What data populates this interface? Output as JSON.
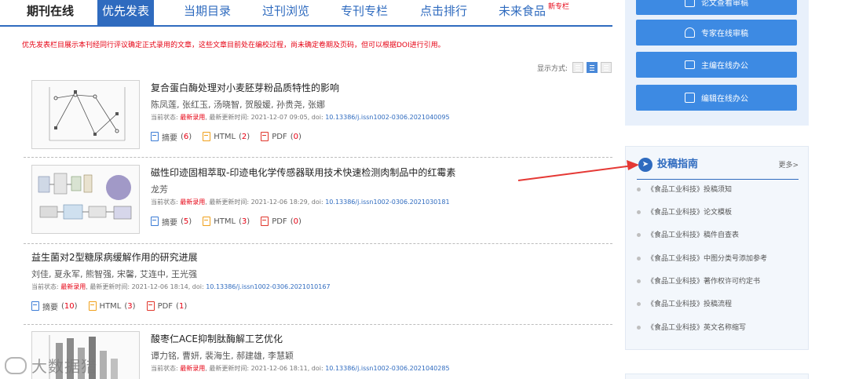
{
  "tabs": {
    "journal_online": "期刊在线",
    "priority": "优先发表",
    "current_toc": "当期目录",
    "past_browse": "过刊浏览",
    "special_column": "专刊专栏",
    "click_rank": "点击排行",
    "future_food": "未来食品",
    "new_badge": "新专栏"
  },
  "notice": "优先发表栏目展示本刊经同行评议确定正式录用的文章，这些文章目前处在编校过程，尚未确定卷期及页码，但可以根据DOI进行引用。",
  "display_mode": {
    "label": "显示方式:",
    "icons": [
      "grid-view-icon",
      "list-view-icon",
      "text-view-icon"
    ],
    "active_index": 1
  },
  "articles": [
    {
      "title": "复合蛋白酶处理对小麦胚芽粉品质特性的影响",
      "authors": "陈凤莲, 张红玉, 汤晓智, 贺殷媛, 孙贵尧, 张娜",
      "status_label": "当前状态:",
      "status": "最新录用",
      "updated_label": "最新更新时间:",
      "updated": "2021-12-07 09:05",
      "doi_label": "doi:",
      "doi": "10.13386/j.issn1002-0306.2021040095",
      "abstract_label": "摘要",
      "abstract_count": "6",
      "html_label": "HTML",
      "html_count": "2",
      "pdf_label": "PDF",
      "pdf_count": "0",
      "has_thumb": true
    },
    {
      "title": "磁性印迹固相萃取-印迹电化学传感器联用技术快速检测肉制品中的红霉素",
      "authors": "龙芳",
      "status_label": "当前状态:",
      "status": "最新录用",
      "updated_label": "最新更新时间:",
      "updated": "2021-12-06 18:29",
      "doi_label": "doi:",
      "doi": "10.13386/j.issn1002-0306.2021030181",
      "abstract_label": "摘要",
      "abstract_count": "5",
      "html_label": "HTML",
      "html_count": "3",
      "pdf_label": "PDF",
      "pdf_count": "0",
      "has_thumb": true
    },
    {
      "title": "益生菌对2型糖尿病缓解作用的研究进展",
      "authors": "刘佳, 夏永军, 熊智强, 宋馨, 艾连中, 王光强",
      "status_label": "当前状态:",
      "status": "最新录用",
      "updated_label": "最新更新时间:",
      "updated": "2021-12-06 18:14",
      "doi_label": "doi:",
      "doi": "10.13386/j.issn1002-0306.2021010167",
      "abstract_label": "摘要",
      "abstract_count": "10",
      "html_label": "HTML",
      "html_count": "3",
      "pdf_label": "PDF",
      "pdf_count": "1",
      "has_thumb": false
    },
    {
      "title": "酸枣仁ACE抑制肽酶解工艺优化",
      "authors": "谭力铭, 曹妍, 裴海生, 郝建雄, 李慧颖",
      "status_label": "当前状态:",
      "status": "最新录用",
      "updated_label": "最新更新时间:",
      "updated": "2021-12-06 18:11",
      "doi_label": "doi:",
      "doi": "10.13386/j.issn1002-0306.2021040285",
      "has_thumb": true
    }
  ],
  "sidebar": {
    "buttons": [
      {
        "label": "论文查看审稿",
        "icon": "document-icon"
      },
      {
        "label": "专家在线审稿",
        "icon": "user-icon"
      },
      {
        "label": "主编在线办公",
        "icon": "monitor-icon"
      },
      {
        "label": "编辑在线办公",
        "icon": "edit-icon"
      }
    ],
    "guide": {
      "title": "投稿指南",
      "more": "更多>",
      "items": [
        "《食品工业科技》投稿须知",
        "《食品工业科技》论文模板",
        "《食品工业科技》稿件自查表",
        "《食品工业科技》中图分类号添加参考",
        "《食品工业科技》著作权许可约定书",
        "《食品工业科技》投稿流程",
        "《食品工业科技》英文名称缩写"
      ]
    }
  },
  "colors": {
    "brand_blue": "#2f6bbf",
    "button_blue": "#3d8ae3",
    "highlight_red": "#e60012",
    "annotation_arrow": "#e53935"
  },
  "watermark": "大数据猎"
}
